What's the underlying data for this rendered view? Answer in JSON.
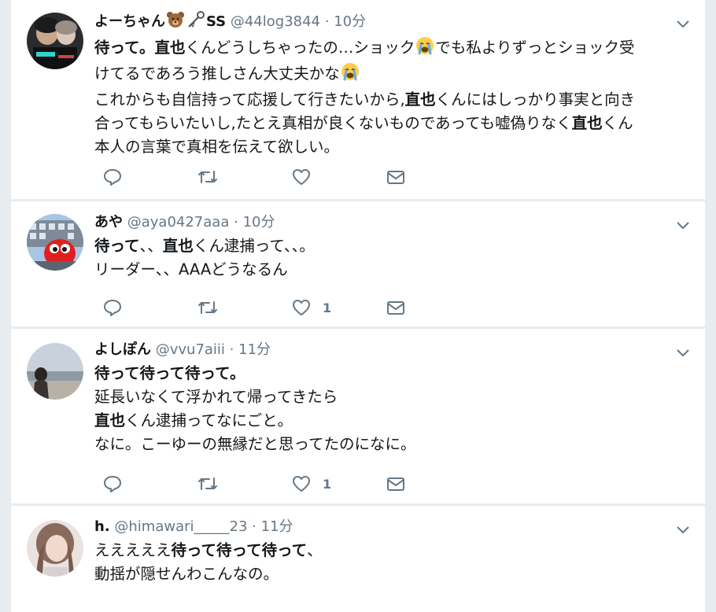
{
  "tweets": [
    {
      "name": "よーちゃん",
      "name_suffix": "SS",
      "handle": "@44log3844",
      "time": "10分",
      "lines": [
        [
          {
            "t": "待って。",
            "b": true
          },
          {
            "t": "直也",
            "b": true
          },
          {
            "t": "くんどうしちゃったの…ショック"
          },
          {
            "e": "cry"
          },
          {
            "t": "でも私よりずっとショック受"
          }
        ],
        [
          {
            "t": "けてるであろう推しさん大丈夫かな"
          },
          {
            "e": "cry"
          }
        ],
        [
          {
            "t": "これからも自信持って応援して行きたいから,"
          },
          {
            "t": "直也",
            "b": true
          },
          {
            "t": "くんにはしっかり事実と向き"
          }
        ],
        [
          {
            "t": "合ってもらいたいし,たとえ真相が良くないものであっても嘘偽りなく"
          },
          {
            "t": "直也",
            "b": true
          },
          {
            "t": "くん"
          }
        ],
        [
          {
            "t": "本人の言葉で真相を伝えて欲しい。"
          }
        ]
      ],
      "like_count": ""
    },
    {
      "name": "あや",
      "handle": "@aya0427aaa",
      "time": "10分",
      "lines": [
        [
          {
            "t": "待って",
            "b": true
          },
          {
            "t": "、、"
          },
          {
            "t": "直也",
            "b": true
          },
          {
            "t": "くん逮捕って、、。"
          }
        ],
        [
          {
            "t": "リーダー、、AAAどうなるん"
          }
        ]
      ],
      "like_count": "1"
    },
    {
      "name": "よしぽん",
      "handle": "@vvu7aiii",
      "time": "11分",
      "lines": [
        [
          {
            "t": "待って待って待って。",
            "b": true
          }
        ],
        [
          {
            "t": "延長いなくて浮かれて帰ってきたら"
          }
        ],
        [
          {
            "t": "直也",
            "b": true
          },
          {
            "t": "くん逮捕ってなにごと。"
          }
        ],
        [
          {
            "t": "なに。こーゆーの無縁だと思ってたのになに。"
          }
        ]
      ],
      "like_count": "1"
    },
    {
      "name": "h.",
      "handle": "@himawari_____23",
      "time": "11分",
      "lines": [
        [
          {
            "t": "えええええ"
          },
          {
            "t": "待って待って待って",
            "b": true
          },
          {
            "t": "、"
          }
        ],
        [
          {
            "t": "動揺が隠せんわこんなの。"
          }
        ]
      ],
      "like_count": ""
    }
  ],
  "ui": {
    "dot": "·",
    "icons": {
      "reply": "reply-icon",
      "retweet": "retweet-icon",
      "like": "heart-icon",
      "dm": "envelope-icon",
      "caret": "chevron-down-icon"
    },
    "colors": {
      "background": "#e6ecf0",
      "card": "#ffffff",
      "muted": "#657786",
      "text": "#14171a"
    }
  }
}
